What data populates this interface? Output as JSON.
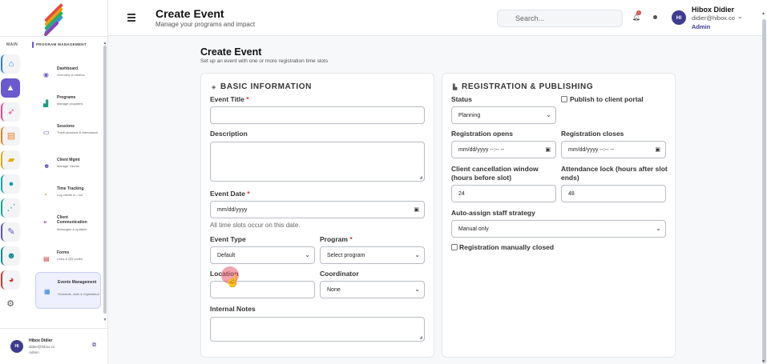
{
  "sidebar": {
    "main_label": "MAIN",
    "section_label": "PROGRAM MANAGEMENT",
    "items": [
      {
        "title": "Dashboard",
        "desc": "Overview & metrics"
      },
      {
        "title": "Programs",
        "desc": "Manage programs"
      },
      {
        "title": "Sessions",
        "desc": "Track sessions & attendance"
      },
      {
        "title": "Client Mgmt",
        "desc": "Manage Clients"
      },
      {
        "title": "Time Tracking",
        "desc": "Log clients in / out"
      },
      {
        "title": "Client Communication",
        "desc": "Messages & updates"
      },
      {
        "title": "Forms",
        "desc": "Links & QR codes"
      },
      {
        "title": "Events Management",
        "desc": "Schedule, slots & registration"
      }
    ],
    "profile": {
      "initials": "HI",
      "name": "Hibox Didier",
      "email": "didier@hibox.co",
      "role": "Admin"
    }
  },
  "header": {
    "title": "Create Event",
    "subtitle": "Manage your programs and impact",
    "search_placeholder": "Search...",
    "notification_count": "1",
    "user": {
      "initials": "HI",
      "name": "Hibox Didier",
      "email": "didier@hibox.co",
      "role": "Admin"
    }
  },
  "page": {
    "title": "Create Event",
    "subtitle": "Set up an event with one or more registration time slots"
  },
  "basic": {
    "section_title": "BASIC INFORMATION",
    "event_title_label": "Event Title",
    "description_label": "Description",
    "event_date_label": "Event Date",
    "event_date_placeholder": "mm/dd/yyyy",
    "event_date_hint": "All time slots occur on this date.",
    "event_type_label": "Event Type",
    "event_type_value": "Default",
    "program_label": "Program",
    "program_value": "Select program",
    "location_label": "Location",
    "coordinator_label": "Coordinator",
    "coordinator_value": "None",
    "notes_label": "Internal Notes",
    "required_mark": "*"
  },
  "registration": {
    "section_title": "REGISTRATION & PUBLISHING",
    "status_label": "Status",
    "status_value": "Planning",
    "publish_label": "Publish to client portal",
    "opens_label": "Registration opens",
    "opens_placeholder": "mm/dd/yyyy --:-- --",
    "closes_label": "Registration closes",
    "closes_placeholder": "mm/dd/yyyy --:-- --",
    "cancel_label": "Client cancellation window (hours before slot)",
    "cancel_value": "24",
    "lock_label": "Attendance lock (hours after slot ends)",
    "lock_value": "48",
    "auto_assign_label": "Auto-assign staff strategy",
    "auto_assign_value": "Manual only",
    "manual_closed_label": "Registration manually closed"
  },
  "colors": {
    "accent": "#6a5acd",
    "avatar": "#3f3c8f",
    "badge": "#e04848"
  }
}
